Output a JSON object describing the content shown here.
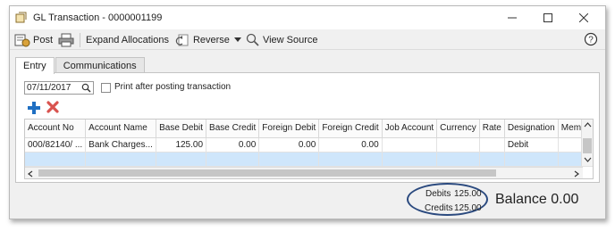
{
  "window": {
    "title": "GL Transaction - 0000001199"
  },
  "toolbar": {
    "post_label": "Post",
    "expand_label": "Expand Allocations",
    "reverse_label": "Reverse",
    "view_source_label": "View Source"
  },
  "tabs": [
    {
      "label": "Entry",
      "active": true
    },
    {
      "label": "Communications",
      "active": false
    }
  ],
  "entry": {
    "date": "07/11/2017",
    "print_after_posting_label": "Print after posting transaction",
    "print_after_posting_checked": false
  },
  "grid": {
    "columns": [
      "Account No",
      "Account Name",
      "Base Debit",
      "Base Credit",
      "Foreign Debit",
      "Foreign Credit",
      "Job Account",
      "Currency",
      "Rate",
      "Designation",
      "Memo"
    ],
    "rows": [
      {
        "account_no": "000/82140/ ...",
        "account_name": "Bank Charges...",
        "base_debit": "125.00",
        "base_credit": "0.00",
        "foreign_debit": "0.00",
        "foreign_credit": "0.00",
        "job_account": "",
        "currency": "",
        "rate": "",
        "designation": "Debit",
        "memo": ""
      }
    ]
  },
  "totals": {
    "debits_label": "Debits",
    "debits_value": "125.00",
    "credits_label": "Credits",
    "credits_value": "125.00",
    "balance_text": "Balance 0.00"
  },
  "colors": {
    "selected_row": "#cfe6fb",
    "add_icon": "#1f6fc2",
    "delete_icon": "#d9534f",
    "highlight_oval": "#2b4a7f"
  }
}
